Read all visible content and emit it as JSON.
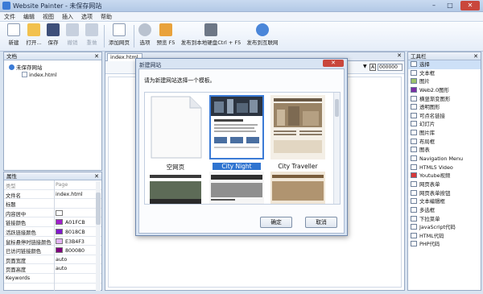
{
  "window": {
    "title": "Website Painter - 未保存网站"
  },
  "menu": [
    "文件",
    "编辑",
    "视图",
    "插入",
    "选项",
    "帮助"
  ],
  "toolbar": {
    "new": "新建",
    "open": "打开...",
    "save": "保存",
    "undo": "撤销",
    "redo": "重做",
    "add_page": "添加网页",
    "options": "选项",
    "preview": "预览 F5",
    "publish_local": "发布到本地硬盘Ctrl + F5",
    "publish_internet": "发布到互联网"
  },
  "documents": {
    "title": "文档",
    "root": "未保存网站",
    "page": "index.html"
  },
  "properties": {
    "title": "属性",
    "rows": [
      {
        "key": "类型",
        "value": "Page",
        "dim": true
      },
      {
        "key": "文件名",
        "value": "index.html"
      },
      {
        "key": "标题",
        "value": ""
      },
      {
        "key": "内容居中",
        "value": "",
        "check": true
      },
      {
        "key": "链接颜色",
        "value": "A01FCB",
        "color": "#a01fcb"
      },
      {
        "key": "活跃链接颜色",
        "value": "8018CB",
        "color": "#8018cb"
      },
      {
        "key": "鼠标悬停时链接颜色",
        "value": "E3B4F3",
        "color": "#e3b4f3"
      },
      {
        "key": "已访问链接颜色",
        "value": "800080",
        "color": "#800080"
      },
      {
        "key": "页面宽度",
        "value": "auto"
      },
      {
        "key": "页面高度",
        "value": "auto"
      },
      {
        "key": "Keywords",
        "value": ""
      }
    ]
  },
  "editor": {
    "tab": "index.html",
    "coordinate": "000000"
  },
  "tools": {
    "title": "工具栏",
    "items": [
      {
        "label": "选择",
        "icon": "arrow-icon"
      },
      {
        "label": "文本框",
        "icon": "text-icon"
      },
      {
        "label": "图片",
        "icon": "image-icon"
      },
      {
        "label": "Web2.0图形",
        "icon": "web20-icon"
      },
      {
        "label": "横竖渐变图形",
        "icon": "gradient-icon"
      },
      {
        "label": "透明图形",
        "icon": "transparent-icon"
      },
      {
        "label": "可点名链接",
        "icon": "link-icon"
      },
      {
        "label": "幻灯片",
        "icon": "slideshow-icon"
      },
      {
        "label": "图片库",
        "icon": "gallery-icon"
      },
      {
        "label": "布局框",
        "icon": "layout-icon"
      },
      {
        "label": "图表",
        "icon": "chart-icon"
      },
      {
        "label": "Navigation Menu",
        "icon": "menu-icon"
      },
      {
        "label": "HTML5 Video",
        "icon": "video-icon"
      },
      {
        "label": "Youtube视频",
        "icon": "youtube-icon"
      },
      {
        "label": "网页表单",
        "icon": "form-icon"
      },
      {
        "label": "网页表单按钮",
        "icon": "form-button-icon"
      },
      {
        "label": "文本编辑框",
        "icon": "textarea-icon"
      },
      {
        "label": "多选框",
        "icon": "checkbox-icon"
      },
      {
        "label": "下拉菜单",
        "icon": "dropdown-icon"
      },
      {
        "label": "JavaScript代码",
        "icon": "js-icon"
      },
      {
        "label": "HTML代码",
        "icon": "html-icon"
      },
      {
        "label": "PHP代码",
        "icon": "php-icon"
      }
    ]
  },
  "dialog": {
    "title": "新建网站",
    "prompt": "请为新建网站选择一个模板。",
    "templates": [
      "空网页",
      "City Night",
      "City Traveller"
    ],
    "selected": "City Night",
    "ok": "确定",
    "cancel": "取消"
  }
}
